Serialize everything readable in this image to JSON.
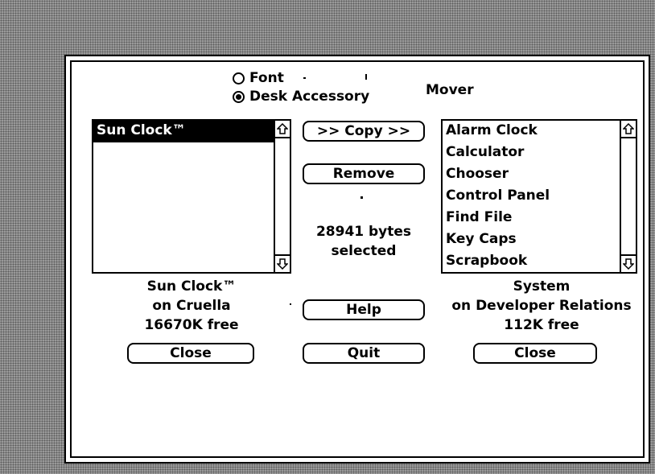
{
  "title": "Mover",
  "mode": {
    "options": [
      {
        "label": "Font",
        "selected": false
      },
      {
        "label": "Desk Accessory",
        "selected": true
      }
    ]
  },
  "left_list": {
    "items": [
      "Sun Clock™"
    ],
    "selected_index": 0
  },
  "right_list": {
    "items": [
      "Alarm Clock",
      "Calculator",
      "Chooser",
      "Control Panel",
      "Find File",
      "Key Caps",
      "Scrapbook"
    ]
  },
  "buttons": {
    "copy": ">> Copy >>",
    "remove": "Remove",
    "help": "Help",
    "quit": "Quit",
    "left_close": "Close",
    "right_close": "Close"
  },
  "status": {
    "line1": "28941 bytes",
    "line2": "selected"
  },
  "left_info": {
    "name": "Sun Clock™",
    "volume": "on Cruella",
    "free": "16670K free"
  },
  "right_info": {
    "name": "System",
    "volume": "on Developer Relations",
    "free": "112K free"
  },
  "colors": {
    "background": "#9a9a9a",
    "dialog": "#ffffff",
    "ink": "#000000"
  }
}
